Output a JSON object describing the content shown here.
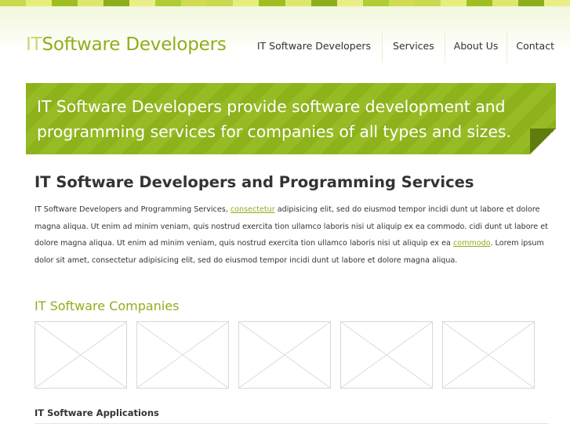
{
  "colors": {
    "accent": "#8fae1b",
    "accent_light": "#c4d96e",
    "banner": "#8db21c",
    "stripe": [
      "#c9d84f",
      "#e6ee7b",
      "#9fbf21",
      "#dde86a",
      "#8cae1c",
      "#e9ef86",
      "#b1cd34",
      "#cfdc52"
    ]
  },
  "header": {
    "logo_prefix": "IT",
    "logo_rest": "Software Developers"
  },
  "nav": {
    "items": [
      {
        "label": "IT Software Developers"
      },
      {
        "label": "Services"
      },
      {
        "label": "About Us"
      },
      {
        "label": "Contact"
      }
    ]
  },
  "banner": {
    "text": "IT Software Developers provide software development and programming services for companies of all types and sizes."
  },
  "main": {
    "heading": "IT Software Developers and Programming Services",
    "para_1": "IT Software Developers and Programming Services, ",
    "link_1": "consectetur",
    "para_2": " adipisicing elit, sed do eiusmod tempor incidi dunt ut labore et dolore magna aliqua. Ut enim ad minim veniam, quis nostrud exercita tion ullamco laboris nisi ut aliquip ex ea commodo. cidi dunt ut labore et dolore magna aliqua. Ut enim ad minim veniam, quis nostrud exercita tion ullamco laboris nisi ut aliquip ex ea ",
    "link_2": "commodo",
    "para_3": ". Lorem ipsum dolor sit amet, consectetur adipisicing elit, sed do eiusmod tempor incidi dunt ut labore et dolore magna aliqua.",
    "companies_heading": "IT Software Companies",
    "thumbnails": [
      "placeholder-image",
      "placeholder-image",
      "placeholder-image",
      "placeholder-image",
      "placeholder-image"
    ],
    "applications_heading": "IT Software Applications"
  }
}
